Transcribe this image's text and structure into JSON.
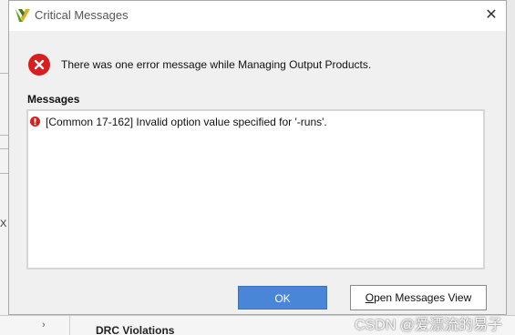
{
  "dialog": {
    "title": "Critical Messages",
    "close_glyph": "✕",
    "summary": "There was one error message while Managing Output Products.",
    "messages_label": "Messages",
    "messages": [
      {
        "severity": "critical",
        "text": "[Common 17-162] Invalid option value specified for '-runs'."
      }
    ],
    "buttons": {
      "ok": "OK",
      "open_mnemonic": "O",
      "open_rest": "pen Messages View"
    }
  },
  "background": {
    "left_fragment": "X",
    "tree_toggle": "›",
    "drc_label": "DRC Violations",
    "watermark": "CSDN @爱漂流的易子"
  },
  "icons": {
    "app": "vivado-logo-icon",
    "error": "error-circle-icon",
    "close": "close-icon"
  },
  "colors": {
    "error_red": "#d81e1e",
    "primary_button": "#4a86d8",
    "logo_green": "#5aa02c",
    "logo_yellow": "#e0b11c"
  }
}
